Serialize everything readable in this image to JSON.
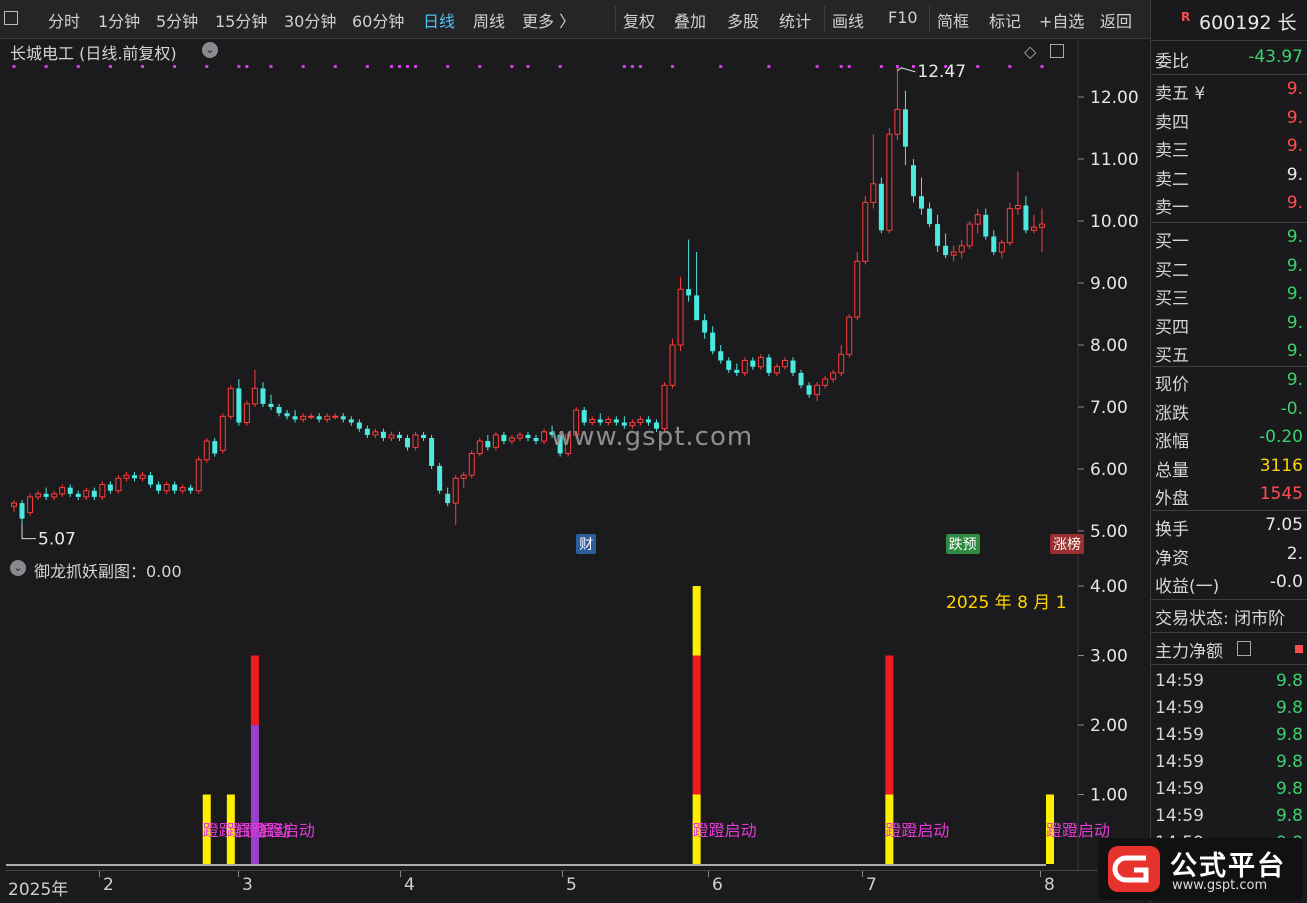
{
  "toolbar": {
    "items": [
      "分时",
      "1分钟",
      "5分钟",
      "15分钟",
      "30分钟",
      "60分钟",
      "日线",
      "周线",
      "更多 〉",
      "复权",
      "叠加",
      "多股",
      "统计",
      "画线",
      "F10",
      "简框",
      "标记",
      "+自选",
      "返回"
    ],
    "active": "日线"
  },
  "main_chart": {
    "title": "长城电工 (日线.前复权)",
    "high_label": "12.47",
    "low_label": "5.07",
    "watermark": "www.gspt.com",
    "tags": {
      "cai": "财",
      "diyu": "跌预",
      "zhangbang": "涨榜"
    },
    "y_ticks": [
      "12.00",
      "11.00",
      "10.00",
      "9.00",
      "8.00",
      "7.00",
      "6.00",
      "5.00"
    ]
  },
  "sub_chart": {
    "title": "御龙抓妖副图：0.00",
    "date_text": "2025 年 8 月 1",
    "signal_label": "蹬蹬启动",
    "y_ticks": [
      "4.00",
      "3.00",
      "2.00",
      "1.00"
    ]
  },
  "x_axis": {
    "labels": [
      "2025年",
      "2",
      "3",
      "4",
      "5",
      "6",
      "7",
      "8"
    ]
  },
  "right_panel": {
    "code_badge": "R",
    "code": "600192 长",
    "weibi": {
      "label": "委比",
      "value": "-43.97"
    },
    "sell": [
      {
        "label": "卖五 ¥",
        "value": "9."
      },
      {
        "label": "卖四",
        "value": "9."
      },
      {
        "label": "卖三",
        "value": "9."
      },
      {
        "label": "卖二",
        "value": "9."
      },
      {
        "label": "卖一",
        "value": "9."
      }
    ],
    "buy": [
      {
        "label": "买一",
        "value": "9."
      },
      {
        "label": "买二",
        "value": "9."
      },
      {
        "label": "买三",
        "value": "9."
      },
      {
        "label": "买四",
        "value": "9."
      },
      {
        "label": "买五",
        "value": "9."
      }
    ],
    "quote": [
      {
        "label": "现价",
        "value": "9."
      },
      {
        "label": "涨跌",
        "value": "-0."
      },
      {
        "label": "涨幅",
        "value": "-0.20"
      },
      {
        "label": "总量",
        "value": "3116"
      },
      {
        "label": "外盘",
        "value": "1545"
      }
    ],
    "stats": [
      {
        "label": "换手",
        "value": "7.05"
      },
      {
        "label": "净资",
        "value": "2."
      },
      {
        "label": "收益(一)",
        "value": "-0.0"
      }
    ],
    "trade_status": "交易状态: 闭市阶",
    "main_flow_label": "主力净额",
    "ticks": [
      {
        "time": "14:59",
        "value": "9.8"
      },
      {
        "time": "14:59",
        "value": "9.8"
      },
      {
        "time": "14:59",
        "value": "9.8"
      },
      {
        "time": "14:59",
        "value": "9.8"
      },
      {
        "time": "14:59",
        "value": "9.8"
      },
      {
        "time": "14:59",
        "value": "9.8"
      },
      {
        "time": "14:59",
        "value": "9.8"
      }
    ]
  },
  "logo": {
    "icon": "gspt-logo-icon",
    "title": "公式平台",
    "url": "www.gspt.com"
  },
  "colors": {
    "up": "#ff3b3b",
    "down": "#4de8e0",
    "signal_yellow": "#ffee00",
    "signal_red": "#ee1c1c",
    "signal_purple": "#9b3fcf",
    "signal_text": "#e23bd6",
    "dots": "#d43fe6"
  },
  "chart_data": [
    {
      "type": "candlestick",
      "title": "长城电工 (日线.前复权)",
      "ylim": [
        4.8,
        12.8
      ],
      "candles": [
        [
          5.4,
          5.5,
          5.3,
          5.45
        ],
        [
          5.45,
          5.5,
          5.1,
          5.2
        ],
        [
          5.3,
          5.6,
          5.25,
          5.55
        ],
        [
          5.55,
          5.65,
          5.5,
          5.6
        ],
        [
          5.6,
          5.7,
          5.5,
          5.55
        ],
        [
          5.55,
          5.65,
          5.5,
          5.6
        ],
        [
          5.6,
          5.75,
          5.55,
          5.7
        ],
        [
          5.7,
          5.75,
          5.55,
          5.6
        ],
        [
          5.6,
          5.65,
          5.5,
          5.55
        ],
        [
          5.55,
          5.7,
          5.5,
          5.65
        ],
        [
          5.65,
          5.7,
          5.5,
          5.55
        ],
        [
          5.55,
          5.8,
          5.5,
          5.75
        ],
        [
          5.75,
          5.8,
          5.6,
          5.65
        ],
        [
          5.65,
          5.9,
          5.6,
          5.85
        ],
        [
          5.85,
          5.95,
          5.8,
          5.9
        ],
        [
          5.9,
          5.95,
          5.8,
          5.85
        ],
        [
          5.85,
          5.95,
          5.8,
          5.9
        ],
        [
          5.9,
          5.95,
          5.7,
          5.75
        ],
        [
          5.75,
          5.8,
          5.6,
          5.65
        ],
        [
          5.65,
          5.8,
          5.6,
          5.75
        ],
        [
          5.75,
          5.8,
          5.6,
          5.65
        ],
        [
          5.65,
          5.75,
          5.6,
          5.7
        ],
        [
          5.7,
          5.75,
          5.6,
          5.65
        ],
        [
          5.65,
          6.2,
          5.6,
          6.15
        ],
        [
          6.15,
          6.5,
          6.1,
          6.45
        ],
        [
          6.45,
          6.5,
          6.2,
          6.25
        ],
        [
          6.3,
          6.9,
          6.25,
          6.85
        ],
        [
          6.85,
          7.35,
          6.8,
          7.3
        ],
        [
          7.3,
          7.45,
          6.7,
          6.75
        ],
        [
          6.75,
          7.1,
          6.7,
          7.05
        ],
        [
          7.05,
          7.6,
          7.0,
          7.3
        ],
        [
          7.3,
          7.4,
          7.0,
          7.05
        ],
        [
          7.05,
          7.2,
          6.95,
          7.0
        ],
        [
          7.0,
          7.05,
          6.85,
          6.9
        ],
        [
          6.9,
          6.95,
          6.8,
          6.85
        ],
        [
          6.85,
          6.95,
          6.75,
          6.8
        ],
        [
          6.8,
          6.9,
          6.75,
          6.85
        ],
        [
          6.85,
          6.9,
          6.8,
          6.85
        ],
        [
          6.85,
          6.9,
          6.75,
          6.8
        ],
        [
          6.8,
          6.9,
          6.75,
          6.85
        ],
        [
          6.85,
          6.9,
          6.8,
          6.85
        ],
        [
          6.85,
          6.9,
          6.75,
          6.8
        ],
        [
          6.8,
          6.85,
          6.7,
          6.75
        ],
        [
          6.75,
          6.8,
          6.6,
          6.65
        ],
        [
          6.65,
          6.7,
          6.5,
          6.55
        ],
        [
          6.55,
          6.65,
          6.5,
          6.6
        ],
        [
          6.6,
          6.65,
          6.45,
          6.5
        ],
        [
          6.5,
          6.6,
          6.45,
          6.55
        ],
        [
          6.55,
          6.6,
          6.45,
          6.5
        ],
        [
          6.5,
          6.55,
          6.3,
          6.35
        ],
        [
          6.35,
          6.6,
          6.3,
          6.55
        ],
        [
          6.55,
          6.6,
          6.45,
          6.5
        ],
        [
          6.5,
          6.55,
          6.0,
          6.05
        ],
        [
          6.05,
          6.1,
          5.6,
          5.65
        ],
        [
          5.6,
          5.7,
          5.4,
          5.45
        ],
        [
          5.45,
          5.9,
          5.1,
          5.85
        ],
        [
          5.85,
          5.95,
          5.7,
          5.9
        ],
        [
          5.9,
          6.3,
          5.85,
          6.25
        ],
        [
          6.25,
          6.5,
          6.2,
          6.45
        ],
        [
          6.45,
          6.55,
          6.3,
          6.35
        ],
        [
          6.35,
          6.6,
          6.3,
          6.55
        ],
        [
          6.55,
          6.6,
          6.4,
          6.45
        ],
        [
          6.45,
          6.55,
          6.4,
          6.5
        ],
        [
          6.5,
          6.6,
          6.45,
          6.55
        ],
        [
          6.55,
          6.6,
          6.45,
          6.5
        ],
        [
          6.5,
          6.55,
          6.4,
          6.45
        ],
        [
          6.45,
          6.65,
          6.4,
          6.6
        ],
        [
          6.6,
          6.7,
          6.5,
          6.55
        ],
        [
          6.55,
          6.6,
          6.2,
          6.25
        ],
        [
          6.25,
          6.6,
          6.2,
          6.55
        ],
        [
          6.55,
          7.0,
          6.5,
          6.95
        ],
        [
          6.95,
          7.0,
          6.7,
          6.75
        ],
        [
          6.75,
          6.85,
          6.7,
          6.8
        ],
        [
          6.8,
          6.9,
          6.7,
          6.75
        ],
        [
          6.75,
          6.85,
          6.7,
          6.8
        ],
        [
          6.8,
          6.85,
          6.7,
          6.75
        ],
        [
          6.75,
          6.85,
          6.65,
          6.7
        ],
        [
          6.7,
          6.8,
          6.65,
          6.75
        ],
        [
          6.75,
          6.85,
          6.7,
          6.8
        ],
        [
          6.8,
          6.85,
          6.7,
          6.75
        ],
        [
          6.75,
          6.8,
          6.6,
          6.65
        ],
        [
          6.65,
          7.4,
          6.6,
          7.35
        ],
        [
          7.35,
          8.1,
          7.3,
          8.0
        ],
        [
          8.0,
          9.1,
          7.9,
          8.9
        ],
        [
          8.9,
          9.7,
          8.7,
          8.8
        ],
        [
          8.8,
          9.5,
          8.6,
          8.4
        ],
        [
          8.4,
          8.5,
          8.1,
          8.2
        ],
        [
          8.2,
          8.3,
          7.85,
          7.9
        ],
        [
          7.9,
          8.0,
          7.7,
          7.75
        ],
        [
          7.75,
          7.8,
          7.55,
          7.6
        ],
        [
          7.6,
          7.7,
          7.5,
          7.55
        ],
        [
          7.55,
          7.8,
          7.5,
          7.75
        ],
        [
          7.75,
          7.8,
          7.6,
          7.65
        ],
        [
          7.65,
          7.85,
          7.6,
          7.8
        ],
        [
          7.8,
          7.85,
          7.5,
          7.55
        ],
        [
          7.55,
          7.7,
          7.5,
          7.65
        ],
        [
          7.65,
          7.8,
          7.6,
          7.75
        ],
        [
          7.75,
          7.8,
          7.5,
          7.55
        ],
        [
          7.55,
          7.6,
          7.3,
          7.35
        ],
        [
          7.35,
          7.4,
          7.15,
          7.2
        ],
        [
          7.2,
          7.4,
          7.1,
          7.35
        ],
        [
          7.35,
          7.5,
          7.3,
          7.45
        ],
        [
          7.45,
          7.6,
          7.4,
          7.55
        ],
        [
          7.55,
          8.0,
          7.5,
          7.85
        ],
        [
          7.85,
          8.5,
          7.8,
          8.45
        ],
        [
          8.45,
          9.5,
          8.4,
          9.35
        ],
        [
          9.35,
          10.4,
          9.3,
          10.3
        ],
        [
          10.3,
          11.4,
          10.2,
          10.6
        ],
        [
          10.6,
          10.7,
          9.8,
          9.85
        ],
        [
          9.85,
          11.5,
          9.8,
          11.4
        ],
        [
          11.4,
          12.47,
          11.3,
          11.8
        ],
        [
          11.8,
          12.1,
          10.9,
          11.2
        ],
        [
          10.9,
          11.0,
          10.3,
          10.4
        ],
        [
          10.4,
          10.7,
          10.1,
          10.2
        ],
        [
          10.2,
          10.3,
          9.9,
          9.95
        ],
        [
          9.95,
          10.1,
          9.5,
          9.6
        ],
        [
          9.6,
          9.8,
          9.4,
          9.45
        ],
        [
          9.45,
          9.6,
          9.35,
          9.5
        ],
        [
          9.5,
          9.7,
          9.4,
          9.6
        ],
        [
          9.6,
          10.0,
          9.55,
          9.95
        ],
        [
          9.95,
          10.2,
          9.8,
          10.1
        ],
        [
          10.1,
          10.2,
          9.7,
          9.75
        ],
        [
          9.75,
          9.85,
          9.45,
          9.5
        ],
        [
          9.5,
          9.7,
          9.4,
          9.65
        ],
        [
          9.65,
          10.3,
          9.6,
          10.2
        ],
        [
          10.2,
          10.8,
          10.1,
          10.25
        ],
        [
          10.25,
          10.4,
          9.8,
          9.85
        ],
        [
          9.85,
          10.1,
          9.8,
          9.9
        ],
        [
          9.9,
          10.2,
          9.5,
          9.95
        ]
      ],
      "marked_high": 12.47,
      "marked_low": 5.07,
      "dot_candle_indices": [
        0,
        4,
        8,
        12,
        16,
        20,
        24,
        28,
        29,
        32,
        36,
        40,
        44,
        47,
        48,
        49,
        50,
        54,
        58,
        62,
        64,
        68,
        76,
        77,
        78,
        82,
        88,
        94,
        100,
        103,
        104,
        108,
        110,
        112,
        116,
        120,
        124,
        128
      ],
      "tags": [
        {
          "text": "财",
          "index": 71
        },
        {
          "text": "跌预",
          "index": 117
        },
        {
          "text": "涨榜",
          "index": 130
        }
      ]
    },
    {
      "type": "bar",
      "title": "御龙抓妖副图：0.00",
      "ylim": [
        0,
        4.4
      ],
      "signals": [
        {
          "index": 24,
          "segments": [
            {
              "value": 1,
              "color": "yellow"
            }
          ],
          "label": "蹬蹬启动"
        },
        {
          "index": 27,
          "segments": [
            {
              "value": 1,
              "color": "yellow"
            }
          ],
          "label": "蹬蹬启动"
        },
        {
          "index": 30,
          "segments": [
            {
              "value": 2,
              "color": "purple"
            },
            {
              "value": 1,
              "color": "red"
            }
          ],
          "label": "蹬蹬启动"
        },
        {
          "index": 85,
          "segments": [
            {
              "value": 1,
              "color": "yellow"
            },
            {
              "value": 2,
              "color": "red"
            },
            {
              "value": 1,
              "color": "yellow"
            }
          ],
          "label": "蹬蹬启动"
        },
        {
          "index": 109,
          "segments": [
            {
              "value": 1,
              "color": "yellow"
            },
            {
              "value": 2,
              "color": "red"
            }
          ],
          "label": "蹬蹬启动"
        },
        {
          "index": 129,
          "segments": [
            {
              "value": 1,
              "color": "yellow"
            }
          ],
          "label": "蹬蹬启动"
        }
      ]
    }
  ]
}
